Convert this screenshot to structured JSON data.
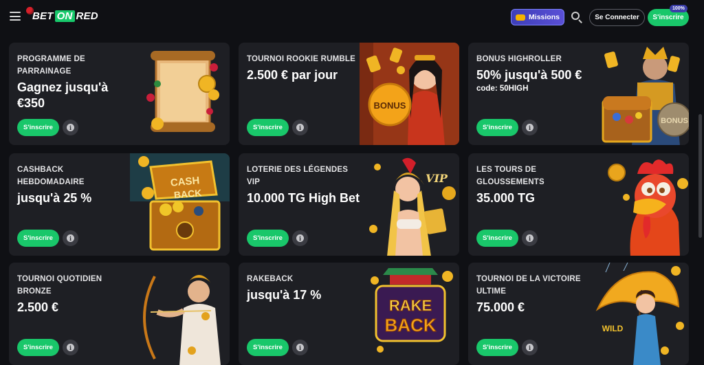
{
  "header": {
    "logo": {
      "part1": "BET",
      "part2": "ON",
      "part3": "RED"
    },
    "missions_label": "Missions",
    "login_label": "Se Connecter",
    "signup_label": "S'inscrire",
    "signup_badge": "100%"
  },
  "promos": [
    {
      "eyebrow": "PROGRAMME DE PARRAINAGE",
      "headline": "Gagnez jusqu'à €350",
      "code": "",
      "cta": "S'inscrire",
      "art": "scroll-art"
    },
    {
      "eyebrow": "TOURNOI ROOKIE RUMBLE",
      "headline": "2.500 € par jour",
      "code": "",
      "cta": "S'inscrire",
      "art": "bonus-girl-art"
    },
    {
      "eyebrow": "BONUS HIGHROLLER",
      "headline": "50% jusqu'à 500 €",
      "code": "code: 50HIGH",
      "cta": "S'inscrire",
      "art": "king-treasure-art"
    },
    {
      "eyebrow": "CASHBACK HEBDOMADAIRE",
      "headline": "jusqu'à 25 %",
      "code": "",
      "cta": "S'inscrire",
      "art": "cashback-chest-art"
    },
    {
      "eyebrow": "LOTERIE DES LÉGENDES VIP",
      "headline": "10.000 TG High Bet",
      "code": "",
      "cta": "S'inscrire",
      "art": "vip-warrior-art"
    },
    {
      "eyebrow": "LES TOURS DE GLOUSSEMENTS",
      "headline": "35.000 TG",
      "code": "",
      "cta": "S'inscrire",
      "art": "rooster-art"
    },
    {
      "eyebrow": "TOURNOI QUOTIDIEN BRONZE",
      "headline": "2.500 €",
      "code": "",
      "cta": "S'inscrire",
      "art": "archer-art"
    },
    {
      "eyebrow": "RAKEBACK",
      "headline": "jusqu'à 17 %",
      "code": "",
      "cta": "S'inscrire",
      "art": "rakeback-logo-art"
    },
    {
      "eyebrow": "TOURNOI DE LA VICTOIRE ULTIME",
      "headline": "75.000 €",
      "code": "",
      "cta": "S'inscrire",
      "art": "umbrella-girl-art"
    }
  ],
  "art_text": {
    "bonus": "BONUS",
    "vip": "VIP",
    "cash": "CASH",
    "back": "BACK",
    "rake": "RAKE",
    "wild": "WILD"
  },
  "colors": {
    "accent_green": "#19c76a",
    "card_bg": "#1e1f24",
    "page_bg": "#0f1014",
    "missions": "#4b47c9"
  }
}
